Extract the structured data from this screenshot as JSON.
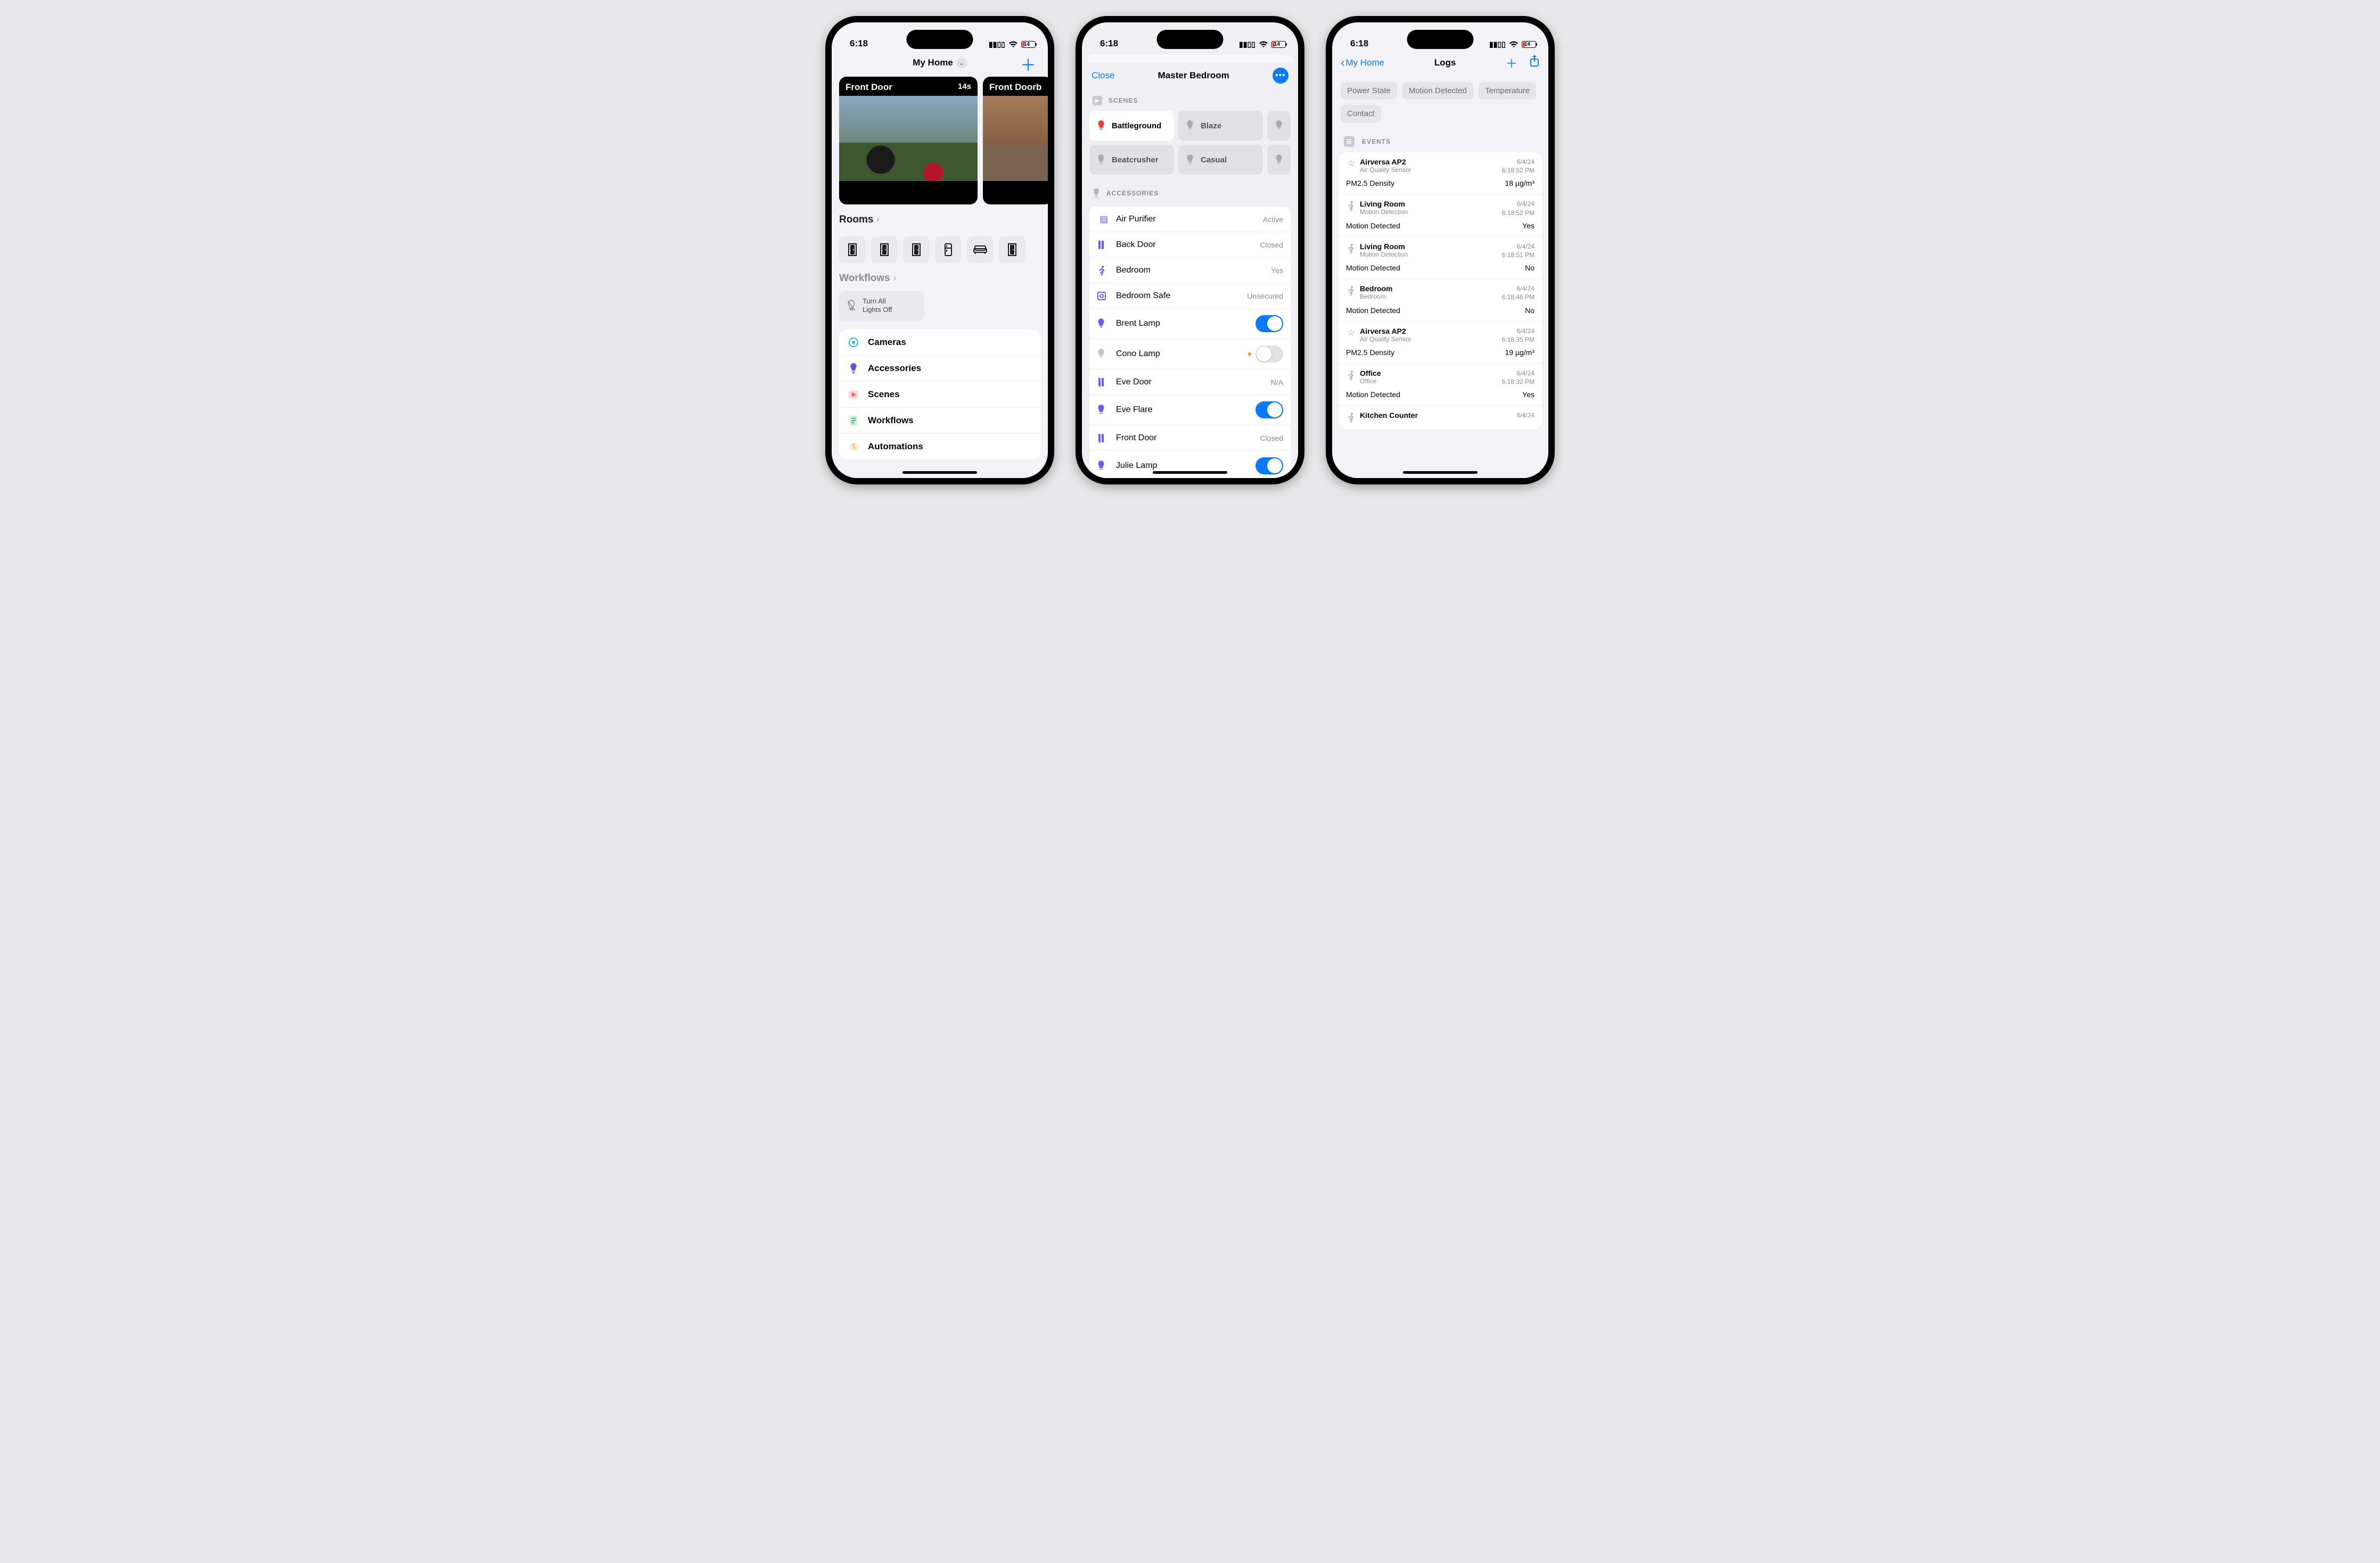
{
  "status": {
    "time": "6:18",
    "battery_pct": "14"
  },
  "phone1": {
    "nav": {
      "title": "My Home",
      "add_glyph": "＋"
    },
    "cameras": [
      {
        "title": "Front Door",
        "age": "14s"
      },
      {
        "title": "Front Doorb"
      }
    ],
    "rooms": {
      "heading": "Rooms",
      "icons": [
        "door",
        "door",
        "door",
        "fridge",
        "couch",
        "door"
      ]
    },
    "workflows": {
      "heading": "Workflows",
      "card": {
        "label": "Turn All\nLights Off"
      }
    },
    "menu": [
      {
        "icon": "camera",
        "label": "Cameras",
        "color": "#2bbad1"
      },
      {
        "icon": "bulb",
        "label": "Accessories",
        "color": "#6153d6"
      },
      {
        "icon": "scene",
        "label": "Scenes",
        "color": "#ff5d55"
      },
      {
        "icon": "workflow",
        "label": "Workflows",
        "color": "#3fbf74"
      },
      {
        "icon": "automation",
        "label": "Automations",
        "color": "#f4b94a"
      }
    ]
  },
  "phone2": {
    "nav": {
      "close": "Close",
      "title": "Master Bedroom"
    },
    "scenes": {
      "heading": "SCENES",
      "items": [
        {
          "label": "Battleground",
          "active": true
        },
        {
          "label": "Blaze",
          "active": false
        },
        {
          "stub": true
        },
        {
          "label": "Beatcrusher",
          "active": false
        },
        {
          "label": "Casual",
          "active": false
        },
        {
          "stub": true
        }
      ]
    },
    "accessories": {
      "heading": "ACCESSORIES",
      "rows": [
        {
          "icon": "purifier",
          "name": "Air Purifier",
          "status": "Active",
          "kind": "status"
        },
        {
          "icon": "door",
          "name": "Back Door",
          "status": "Closed",
          "kind": "status"
        },
        {
          "icon": "motion",
          "name": "Bedroom",
          "status": "Yes",
          "kind": "status"
        },
        {
          "icon": "safe",
          "name": "Bedroom Safe",
          "status": "Unsecured",
          "kind": "status"
        },
        {
          "icon": "bulb",
          "name": "Brent Lamp",
          "kind": "toggle",
          "on": true
        },
        {
          "icon": "bulb-off",
          "name": "Cono Lamp",
          "kind": "toggle",
          "on": false,
          "dot": true
        },
        {
          "icon": "door",
          "name": "Eve Door",
          "status": "N/A",
          "kind": "status"
        },
        {
          "icon": "bulb",
          "name": "Eve Flare",
          "kind": "toggle",
          "on": true
        },
        {
          "icon": "door",
          "name": "Front Door",
          "status": "Closed",
          "kind": "status"
        },
        {
          "icon": "bulb",
          "name": "Julie Lamp",
          "kind": "toggle",
          "on": true
        }
      ]
    }
  },
  "phone3": {
    "nav": {
      "back": "My Home",
      "title": "Logs"
    },
    "filters": [
      "Power State",
      "Motion Detected",
      "Temperature",
      "Contact"
    ],
    "events": {
      "heading": "EVENTS",
      "rows": [
        {
          "icon": "aq",
          "acc": "Airversa AP2",
          "sub": "Air Quality Sensor",
          "date": "6/4/24",
          "time": "6:18:52 PM",
          "metric": "PM2.5 Density",
          "value": "18 µg/m³"
        },
        {
          "icon": "motion",
          "acc": "Living Room",
          "sub": "Motion Detection",
          "date": "6/4/24",
          "time": "6:18:52 PM",
          "metric": "Motion Detected",
          "value": "Yes"
        },
        {
          "icon": "motion",
          "acc": "Living Room",
          "sub": "Motion Detection",
          "date": "6/4/24",
          "time": "6:18:51 PM",
          "metric": "Motion Detected",
          "value": "No"
        },
        {
          "icon": "motion",
          "acc": "Bedroom",
          "sub": "Bedroom",
          "date": "6/4/24",
          "time": "6:18:46 PM",
          "metric": "Motion Detected",
          "value": "No"
        },
        {
          "icon": "aq",
          "acc": "Airversa AP2",
          "sub": "Air Quality Sensor",
          "date": "6/4/24",
          "time": "6:18:35 PM",
          "metric": "PM2.5 Density",
          "value": "19 µg/m³"
        },
        {
          "icon": "motion",
          "acc": "Office",
          "sub": "Office",
          "date": "6/4/24",
          "time": "6:18:32 PM",
          "metric": "Motion Detected",
          "value": "Yes"
        },
        {
          "icon": "motion",
          "acc": "Kitchen Counter",
          "sub": "",
          "date": "6/4/24",
          "time": "",
          "metric": "",
          "value": ""
        }
      ]
    }
  }
}
